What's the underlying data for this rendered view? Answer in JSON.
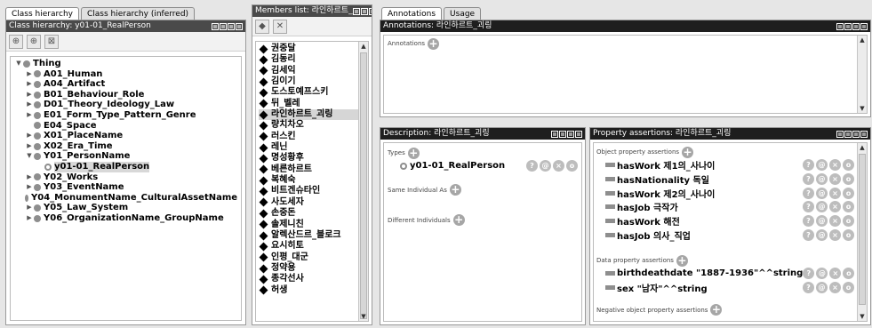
{
  "class_panel": {
    "tabs": [
      "Class hierarchy",
      "Class hierarchy (inferred)"
    ],
    "title": "Class hierarchy: y01-01_RealPerson",
    "toolbar_icons": [
      "add-subclass-icon",
      "add-sibling-class-icon",
      "delete-class-icon"
    ],
    "tree": [
      {
        "label": "Thing",
        "level": 0,
        "expander": "▼",
        "kind": "class"
      },
      {
        "label": "A01_Human",
        "level": 1,
        "expander": "▶",
        "kind": "class"
      },
      {
        "label": "A04_Artifact",
        "level": 1,
        "expander": "▶",
        "kind": "class"
      },
      {
        "label": "B01_Behaviour_Role",
        "level": 1,
        "expander": "▶",
        "kind": "class"
      },
      {
        "label": "D01_Theory_Ideology_Law",
        "level": 1,
        "expander": "▶",
        "kind": "class"
      },
      {
        "label": "E01_Form_Type_Pattern_Genre",
        "level": 1,
        "expander": "▶",
        "kind": "class"
      },
      {
        "label": "E04_Space",
        "level": 1,
        "expander": "",
        "kind": "class"
      },
      {
        "label": "X01_PlaceName",
        "level": 1,
        "expander": "▶",
        "kind": "class"
      },
      {
        "label": "X02_Era_Time",
        "level": 1,
        "expander": "▶",
        "kind": "class"
      },
      {
        "label": "Y01_PersonName",
        "level": 1,
        "expander": "▼",
        "kind": "class"
      },
      {
        "label": "y01-01_RealPerson",
        "level": 2,
        "expander": "",
        "kind": "individual",
        "selected": true
      },
      {
        "label": "Y02_Works",
        "level": 1,
        "expander": "▶",
        "kind": "class"
      },
      {
        "label": "Y03_EventName",
        "level": 1,
        "expander": "▶",
        "kind": "class"
      },
      {
        "label": "Y04_MonumentName_CulturalAssetName",
        "level": 1,
        "expander": "",
        "kind": "individual"
      },
      {
        "label": "Y05_Law_System",
        "level": 1,
        "expander": "▶",
        "kind": "class"
      },
      {
        "label": "Y06_OrganizationName_GroupName",
        "level": 1,
        "expander": "▶",
        "kind": "class"
      }
    ]
  },
  "members_panel": {
    "title": "Members list: 라인하르트_",
    "toolbar_icons": [
      "add-individual-icon",
      "delete-individual-icon"
    ],
    "items": [
      "권중달",
      "김동리",
      "김세익",
      "김이기",
      "도스토예프스키",
      "뒤_벨레",
      "라인하르트_괴링",
      "량치차오",
      "러스킨",
      "레닌",
      "명성황후",
      "베른하르트",
      "복혜숙",
      "비트겐슈타인",
      "사도세자",
      "손중돈",
      "솔제니친",
      "알렉산드르_블로크",
      "요시히토",
      "인평_대군",
      "정약용",
      "종각선사",
      "허생"
    ],
    "selected_index": 6
  },
  "annotations_panel": {
    "tabs": [
      "Annotations",
      "Usage"
    ],
    "title": "Annotations: 라인하르트_괴링",
    "section_label": "Annotations"
  },
  "description_panel": {
    "title": "Description: 라인하르트_괴링",
    "types_label": "Types",
    "types": [
      "y01-01_RealPerson"
    ],
    "same_label": "Same Individual As",
    "different_label": "Different Individuals"
  },
  "property_panel": {
    "title": "Property assertions: 라인하르트_괴링",
    "object_label": "Object property assertions",
    "object_assertions": [
      "hasWork 제1의_사나이",
      "hasNationality 독일",
      "hasWork 제2의_사나이",
      "hasJob 극작가",
      "hasWork 해전",
      "hasJob 의사_직업"
    ],
    "data_label": "Data property assertions",
    "data_assertions": [
      "birthdeathdate \"1887-1936\"^^string",
      "sex \"남자\"^^string"
    ],
    "negative_label": "Negative object property assertions"
  },
  "row_buttons": [
    "?",
    "@",
    "×",
    "o"
  ]
}
